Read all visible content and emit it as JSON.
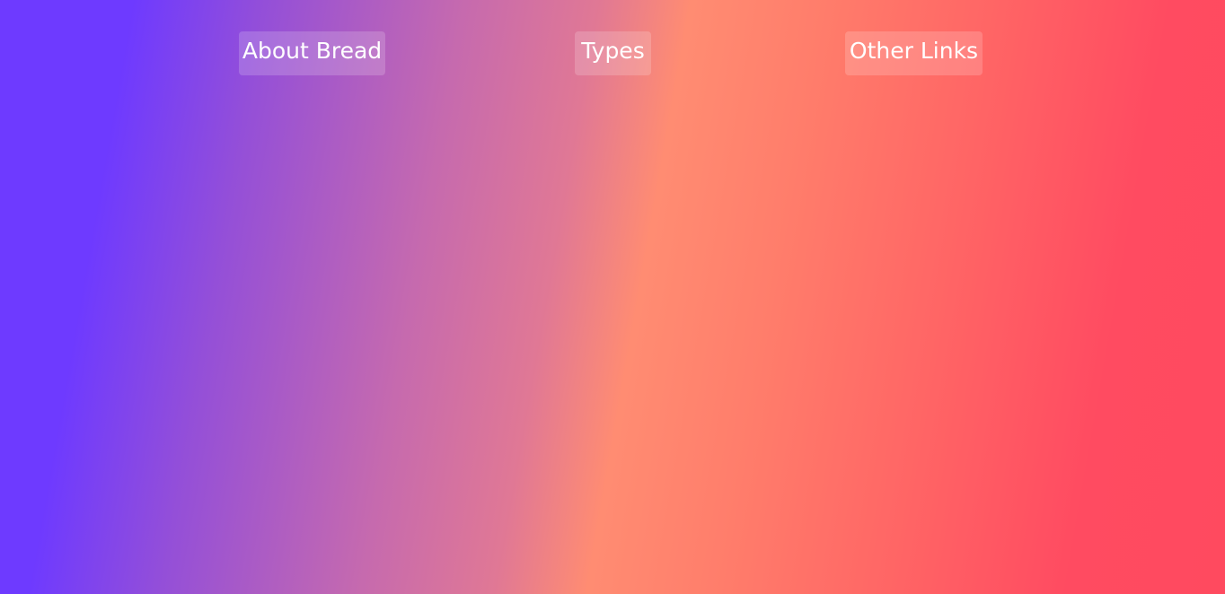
{
  "nav": {
    "items": [
      {
        "label": "About Bread"
      },
      {
        "label": "Types"
      },
      {
        "label": "Other Links"
      }
    ]
  },
  "colors": {
    "gradient_start": "#6e3aff",
    "gradient_mid": "#ff8c72",
    "gradient_end": "#ff4a5f",
    "link_text": "#ffffff"
  }
}
